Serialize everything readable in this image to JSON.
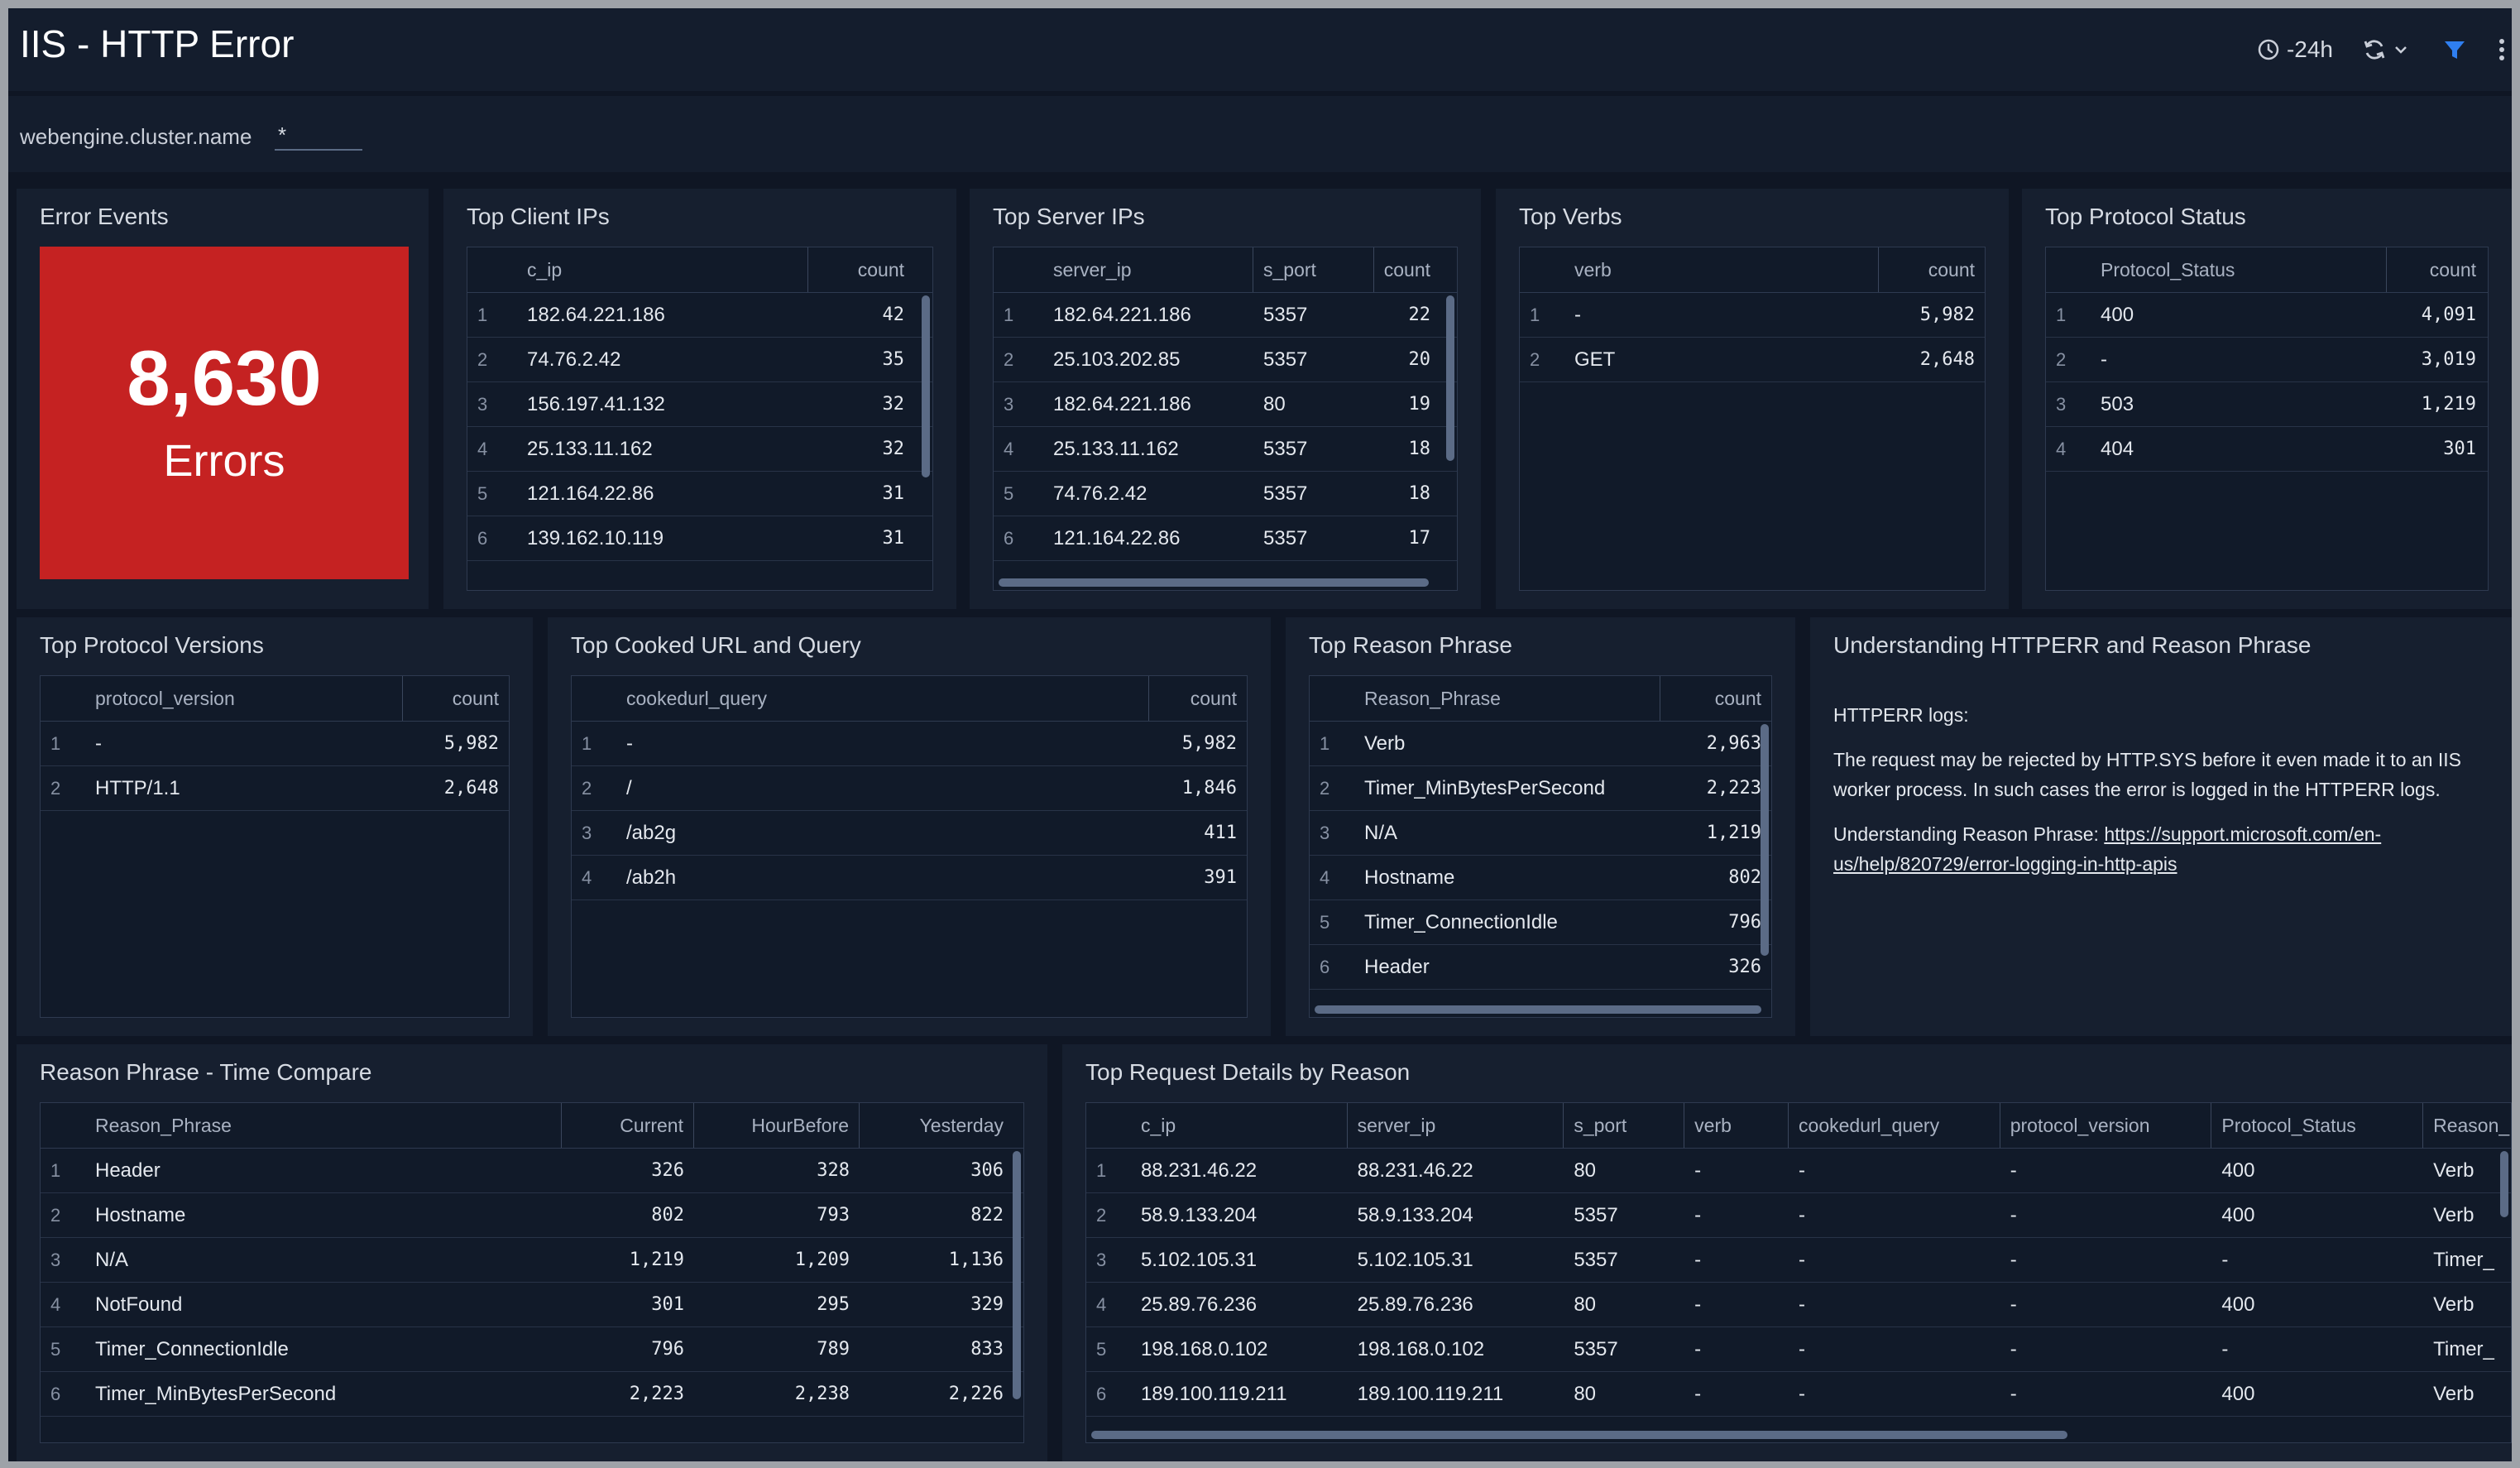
{
  "header": {
    "title": "IIS - HTTP Error",
    "time_range": "-24h"
  },
  "filter": {
    "label": "webengine.cluster.name",
    "value": "*"
  },
  "error_events": {
    "title": "Error Events",
    "value": "8,630",
    "unit": "Errors",
    "color": "#c52222"
  },
  "top_client_ips": {
    "title": "Top Client IPs",
    "columns": [
      "c_ip",
      "count"
    ],
    "rows": [
      {
        "idx": "1",
        "c_ip": "182.64.221.186",
        "count": "42"
      },
      {
        "idx": "2",
        "c_ip": "74.76.2.42",
        "count": "35"
      },
      {
        "idx": "3",
        "c_ip": "156.197.41.132",
        "count": "32"
      },
      {
        "idx": "4",
        "c_ip": "25.133.11.162",
        "count": "32"
      },
      {
        "idx": "5",
        "c_ip": "121.164.22.86",
        "count": "31"
      },
      {
        "idx": "6",
        "c_ip": "139.162.10.119",
        "count": "31"
      }
    ]
  },
  "top_server_ips": {
    "title": "Top Server IPs",
    "columns": [
      "server_ip",
      "s_port",
      "count"
    ],
    "rows": [
      {
        "idx": "1",
        "server_ip": "182.64.221.186",
        "s_port": "5357",
        "count": "22"
      },
      {
        "idx": "2",
        "server_ip": "25.103.202.85",
        "s_port": "5357",
        "count": "20"
      },
      {
        "idx": "3",
        "server_ip": "182.64.221.186",
        "s_port": "80",
        "count": "19"
      },
      {
        "idx": "4",
        "server_ip": "25.133.11.162",
        "s_port": "5357",
        "count": "18"
      },
      {
        "idx": "5",
        "server_ip": "74.76.2.42",
        "s_port": "5357",
        "count": "18"
      },
      {
        "idx": "6",
        "server_ip": "121.164.22.86",
        "s_port": "5357",
        "count": "17"
      }
    ]
  },
  "top_verbs": {
    "title": "Top Verbs",
    "columns": [
      "verb",
      "count"
    ],
    "rows": [
      {
        "idx": "1",
        "verb": "-",
        "count": "5,982"
      },
      {
        "idx": "2",
        "verb": "GET",
        "count": "2,648"
      }
    ]
  },
  "top_protocol_status": {
    "title": "Top Protocol Status",
    "columns": [
      "Protocol_Status",
      "count"
    ],
    "rows": [
      {
        "idx": "1",
        "status": "400",
        "count": "4,091"
      },
      {
        "idx": "2",
        "status": "-",
        "count": "3,019"
      },
      {
        "idx": "3",
        "status": "503",
        "count": "1,219"
      },
      {
        "idx": "4",
        "status": "404",
        "count": "301"
      }
    ]
  },
  "top_protocol_versions": {
    "title": "Top Protocol Versions",
    "columns": [
      "protocol_version",
      "count"
    ],
    "rows": [
      {
        "idx": "1",
        "version": "-",
        "count": "5,982"
      },
      {
        "idx": "2",
        "version": "HTTP/1.1",
        "count": "2,648"
      }
    ]
  },
  "top_cooked_url": {
    "title": "Top Cooked URL and Query",
    "columns": [
      "cookedurl_query",
      "count"
    ],
    "rows": [
      {
        "idx": "1",
        "url": "-",
        "count": "5,982"
      },
      {
        "idx": "2",
        "url": "/",
        "count": "1,846"
      },
      {
        "idx": "3",
        "url": "/ab2g",
        "count": "411"
      },
      {
        "idx": "4",
        "url": "/ab2h",
        "count": "391"
      }
    ]
  },
  "top_reason_phrase": {
    "title": "Top Reason Phrase",
    "columns": [
      "Reason_Phrase",
      "count"
    ],
    "rows": [
      {
        "idx": "1",
        "phrase": "Verb",
        "count": "2,963"
      },
      {
        "idx": "2",
        "phrase": "Timer_MinBytesPerSecond",
        "count": "2,223"
      },
      {
        "idx": "3",
        "phrase": "N/A",
        "count": "1,219"
      },
      {
        "idx": "4",
        "phrase": "Hostname",
        "count": "802"
      },
      {
        "idx": "5",
        "phrase": "Timer_ConnectionIdle",
        "count": "796"
      },
      {
        "idx": "6",
        "phrase": "Header",
        "count": "326"
      }
    ]
  },
  "understanding": {
    "title": "Understanding HTTPERR and Reason Phrase",
    "heading": "HTTPERR logs:",
    "body": "The request may be rejected by HTTP.SYS before it even made it to an IIS worker process. In such cases the error is logged in the HTTPERR logs.",
    "link_label": "Understanding Reason Phrase:",
    "link_url": "https://support.microsoft.com/en-us/help/820729/error-logging-in-http-apis"
  },
  "reason_time_compare": {
    "title": "Reason Phrase - Time Compare",
    "columns": [
      "Reason_Phrase",
      "Current",
      "HourBefore",
      "Yesterday"
    ],
    "rows": [
      {
        "idx": "1",
        "phrase": "Header",
        "current": "326",
        "hour_before": "328",
        "yesterday": "306"
      },
      {
        "idx": "2",
        "phrase": "Hostname",
        "current": "802",
        "hour_before": "793",
        "yesterday": "822"
      },
      {
        "idx": "3",
        "phrase": "N/A",
        "current": "1,219",
        "hour_before": "1,209",
        "yesterday": "1,136"
      },
      {
        "idx": "4",
        "phrase": "NotFound",
        "current": "301",
        "hour_before": "295",
        "yesterday": "329"
      },
      {
        "idx": "5",
        "phrase": "Timer_ConnectionIdle",
        "current": "796",
        "hour_before": "789",
        "yesterday": "833"
      },
      {
        "idx": "6",
        "phrase": "Timer_MinBytesPerSecond",
        "current": "2,223",
        "hour_before": "2,238",
        "yesterday": "2,226"
      }
    ]
  },
  "top_request_details": {
    "title": "Top Request Details by Reason",
    "columns": [
      "c_ip",
      "server_ip",
      "s_port",
      "verb",
      "cookedurl_query",
      "protocol_version",
      "Protocol_Status",
      "Reason_"
    ],
    "rows": [
      {
        "idx": "1",
        "c_ip": "88.231.46.22",
        "server_ip": "88.231.46.22",
        "s_port": "80",
        "verb": "-",
        "url": "-",
        "version": "-",
        "status": "400",
        "reason": "Verb"
      },
      {
        "idx": "2",
        "c_ip": "58.9.133.204",
        "server_ip": "58.9.133.204",
        "s_port": "5357",
        "verb": "-",
        "url": "-",
        "version": "-",
        "status": "400",
        "reason": "Verb"
      },
      {
        "idx": "3",
        "c_ip": "5.102.105.31",
        "server_ip": "5.102.105.31",
        "s_port": "5357",
        "verb": "-",
        "url": "-",
        "version": "-",
        "status": "-",
        "reason": "Timer_"
      },
      {
        "idx": "4",
        "c_ip": "25.89.76.236",
        "server_ip": "25.89.76.236",
        "s_port": "80",
        "verb": "-",
        "url": "-",
        "version": "-",
        "status": "400",
        "reason": "Verb"
      },
      {
        "idx": "5",
        "c_ip": "198.168.0.102",
        "server_ip": "198.168.0.102",
        "s_port": "5357",
        "verb": "-",
        "url": "-",
        "version": "-",
        "status": "-",
        "reason": "Timer_"
      },
      {
        "idx": "6",
        "c_ip": "189.100.119.211",
        "server_ip": "189.100.119.211",
        "s_port": "80",
        "verb": "-",
        "url": "-",
        "version": "-",
        "status": "400",
        "reason": "Verb"
      }
    ]
  }
}
